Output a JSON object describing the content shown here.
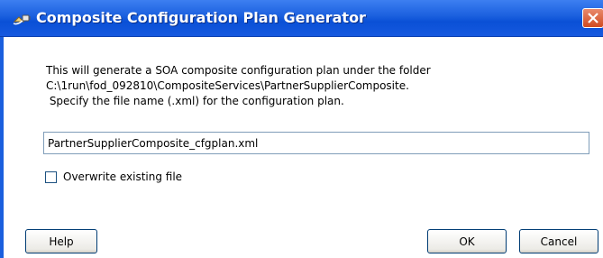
{
  "window": {
    "title": "Composite Configuration Plan Generator",
    "icon": "plug-icon",
    "close_icon": "close-icon",
    "accent_color": "#1a5fde",
    "close_color": "#d04a20"
  },
  "message": {
    "line1": "This will generate a SOA composite configuration plan under the folder",
    "line2": "C:\\1run\\fod_092810\\CompositeServices\\PartnerSupplierComposite.",
    "line3": " Specify the file name (.xml) for the configuration plan."
  },
  "filename": {
    "value": "PartnerSupplierComposite_cfgplan.xml"
  },
  "overwrite": {
    "label": "Overwrite existing file",
    "checked": false
  },
  "buttons": {
    "help": "Help",
    "ok": "OK",
    "cancel": "Cancel"
  }
}
